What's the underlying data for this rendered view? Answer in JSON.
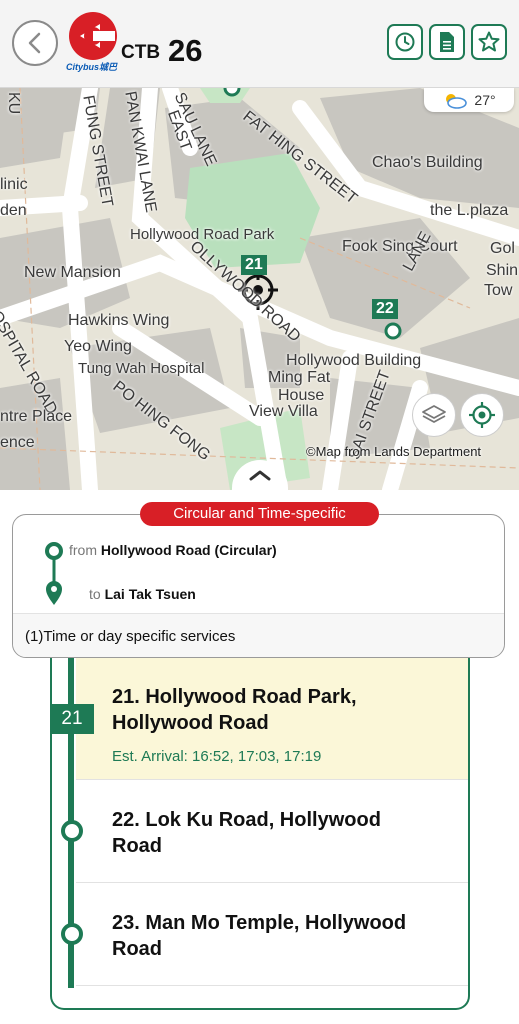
{
  "header": {
    "logo_text": "Citybus城巴",
    "company": "CTB",
    "route_number": "26"
  },
  "map": {
    "weather_temp": "27°",
    "labels": {
      "street_ku": "KU",
      "fung_street": "FUNG STREET",
      "pan_kwai_lane": "PAN KWAI LANE",
      "sau_lane": "SAU LANE",
      "east": "EAST",
      "fat_hing_street": "FAT HING STREET",
      "chaos_building": "Chao's Building",
      "linic": "linic",
      "den": "den",
      "the_plaza": "the L.plaza",
      "hollywood_road_park": "Hollywood Road Park",
      "fook_sing_court": "Fook Sing Court",
      "gol": "Gol",
      "shin": "Shin",
      "tow": "Tow",
      "new_mansion": "New Mansion",
      "hawkins_wing": "Hawkins Wing",
      "yeo_wing": "Yeo Wing",
      "tung_wah_hospital": "Tung Wah Hospital",
      "hollywood_road": "OLLYWOOD ROAD",
      "lane": "LANE",
      "hospital_road": "OSPITAL ROAD",
      "hollywood_building": "Hollywood Building",
      "ming_fat_house": "Ming Fat",
      "ming_fat_house_2": "House",
      "view_villa": "View Villa",
      "po_hing_fong": "PO HING FONG",
      "centre_place": "ntre Place",
      "ence": "ence",
      "sai_street": "SAI STREET"
    },
    "stop_tag_current": "21",
    "stop_tag_next": "22",
    "copyright": "©Map from Lands Department"
  },
  "route_info": {
    "badge": "Circular and Time-specific",
    "from_label": "from",
    "from_value": "Hollywood Road (Circular)",
    "to_label": "to",
    "to_value": "Lai Tak Tsuen",
    "note": "(1)Time or day specific services"
  },
  "stops": {
    "current_number": "21",
    "items": [
      {
        "name": "21. Hollywood Road Park, Hollywood Road",
        "eta": "Est. Arrival: 16:52, 17:03, 17:19"
      },
      {
        "name": "22. Lok Ku Road, Hollywood Road"
      },
      {
        "name": "23. Man Mo Temple, Hollywood Road"
      }
    ]
  },
  "colors": {
    "accent_green": "#1e7a55",
    "brand_red": "#d81f26",
    "highlight": "#fbf7d8"
  }
}
